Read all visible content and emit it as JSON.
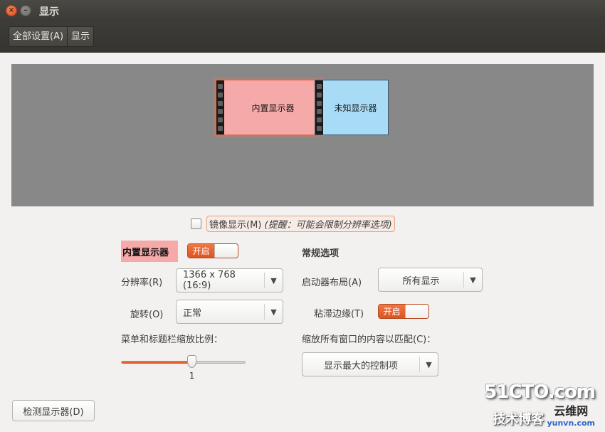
{
  "window": {
    "title": "显示",
    "close_glyph": "×",
    "minimize_glyph": "–"
  },
  "toolbar": {
    "breadcrumbs": [
      "全部设置(A)",
      "显示"
    ]
  },
  "arrangement": {
    "monitors": [
      {
        "label": "内置显示器",
        "color": "#f6a9a9"
      },
      {
        "label": "未知显示器",
        "color": "#a8dcf6"
      }
    ]
  },
  "mirror": {
    "checked": false,
    "label": "镜像显示(M)",
    "hint": "(提醒：可能会限制分辨率选项)"
  },
  "builtin_display": {
    "name": "内置显示器",
    "switch_label": "开启",
    "switch_on": true,
    "resolution_label": "分辨率(R)",
    "resolution_value": "1366 x 768 (16:9)",
    "rotation_label": "旋转(O)",
    "rotation_value": "正常",
    "scale_label": "菜单和标题栏缩放比例：",
    "scale_value": "1",
    "scale_fraction": 0.57
  },
  "general": {
    "title": "常规选项",
    "launcher_label": "启动器布局(A)",
    "launcher_value": "所有显示",
    "sticky_label": "粘滞边缘(T)",
    "sticky_switch_label": "开启",
    "sticky_on": true,
    "fit_label": "缩放所有窗口的内容以匹配(C)：",
    "fit_value": "显示最大的控制项"
  },
  "detect_button": "检测显示器(D)",
  "watermark": {
    "line1": "51CTO.com",
    "line2": "技术博客",
    "site": "云维网",
    "url": "yunvn.com"
  },
  "colors": {
    "accent": "#dd5420",
    "titlebar": "#3c3b37",
    "window_bg": "#f2f1f0"
  }
}
